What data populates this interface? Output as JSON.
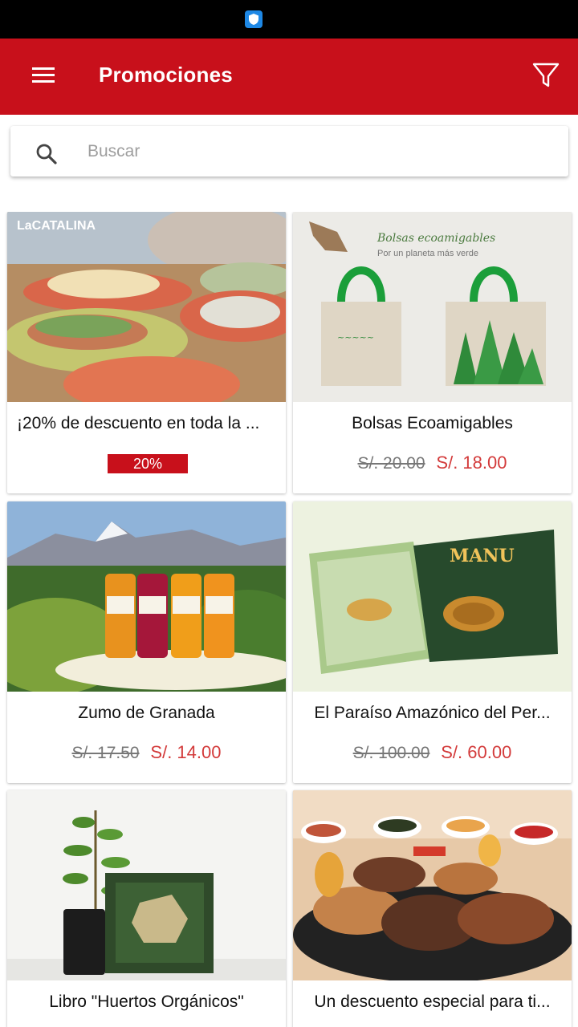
{
  "app_bar": {
    "title": "Promociones",
    "menu_icon": "menu-icon",
    "filter_icon": "filter-icon",
    "background": "#c8101b"
  },
  "search": {
    "placeholder": "Buscar",
    "value": ""
  },
  "promotions": [
    {
      "title": "¡20% de descuento en toda la ...",
      "badge": "20%",
      "image": "restaurant-food-image",
      "brand_mark": "LaCATALINA"
    },
    {
      "title": "Bolsas Ecoamigables",
      "old_price": "S/. 20.00",
      "new_price": "S/. 18.00",
      "image": "eco-bags-image",
      "image_heading": "Bolsas ecoamigables",
      "image_subheading": "Por un planeta más verde"
    },
    {
      "title": "Zumo de Granada",
      "old_price": "S/. 17.50",
      "new_price": "S/. 14.00",
      "image": "juice-bottles-image"
    },
    {
      "title": "El Paraíso Amazónico del Per...",
      "old_price": "S/. 100.00",
      "new_price": "S/. 60.00",
      "image": "manu-book-image",
      "book_title": "MANU"
    },
    {
      "title": "Libro \"Huertos Orgánicos\"",
      "image": "plant-book-image"
    },
    {
      "title": "Un descuento especial para ti...",
      "image": "grill-platter-image"
    }
  ]
}
